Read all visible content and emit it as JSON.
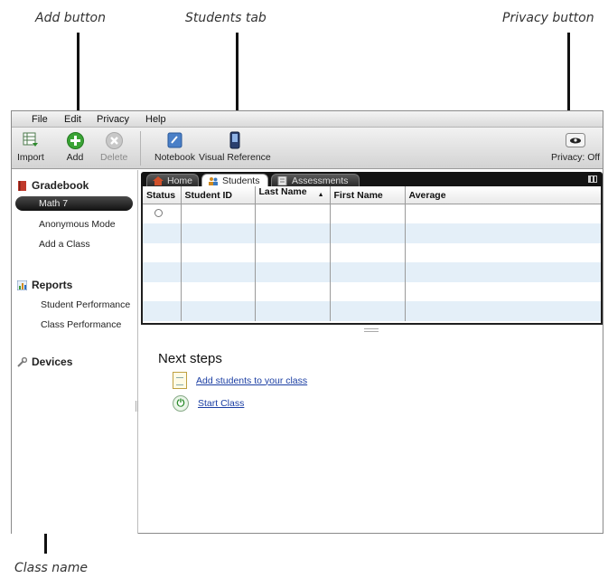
{
  "callouts": {
    "add_button": "Add button",
    "students_tab": "Students tab",
    "privacy_button": "Privacy button",
    "class_name": "Class name"
  },
  "menubar": {
    "file": "File",
    "edit": "Edit",
    "privacy": "Privacy",
    "help": "Help"
  },
  "toolbar": {
    "import": "Import",
    "add": "Add",
    "delete": "Delete",
    "notebook": "Notebook",
    "visual_reference": "Visual Reference",
    "privacy": "Privacy: Off"
  },
  "sidebar": {
    "gradebook": "Gradebook",
    "class_selected": "Math 7",
    "anonymous_mode": "Anonymous Mode",
    "add_class": "Add a Class",
    "reports": "Reports",
    "student_performance": "Student Performance",
    "class_performance": "Class Performance",
    "devices": "Devices"
  },
  "tabs": {
    "home": "Home",
    "students": "Students",
    "assessments": "Assessments"
  },
  "table": {
    "columns": [
      "Status",
      "Student ID",
      "Last Name",
      "First Name",
      "Average"
    ]
  },
  "next_steps": {
    "title": "Next steps",
    "add_students": "Add students to your class",
    "start_class": "Start Class"
  },
  "colors": {
    "add_green": "#3aa335",
    "row_alt": "#e4eff8",
    "link_blue": "#1b3ea3",
    "gradebook_red": "#c0392b"
  }
}
